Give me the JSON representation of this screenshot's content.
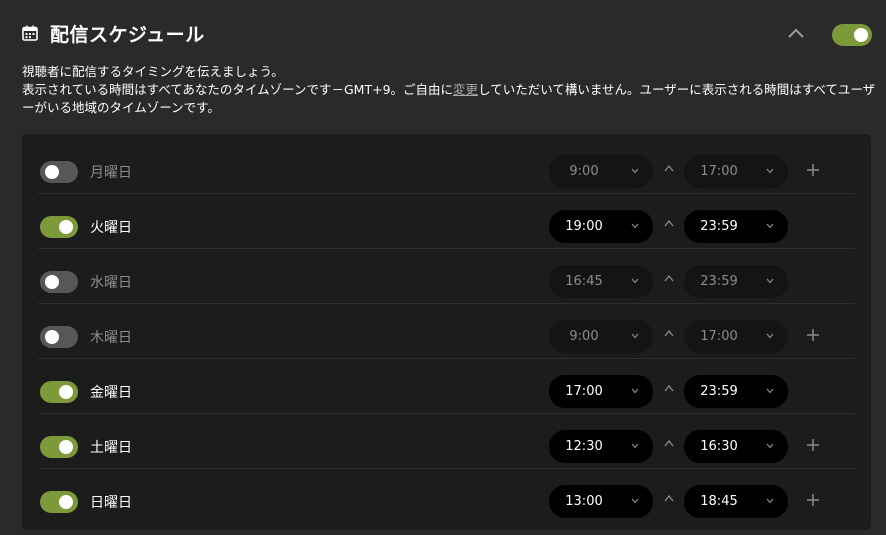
{
  "header": {
    "title": "配信スケジュール",
    "enabled": true
  },
  "description": {
    "line1": "視聴者に配信するタイミングを伝えましょう。",
    "line2_before": "表示されている時間はすべてあなたのタイムゾーンです－GMT+9。ご自由に",
    "line2_link": "変更",
    "line2_after": "していただいて構いません。ユーザーに表示される時間はすべてユーザーがいる地域のタイムゾーンです。"
  },
  "days": [
    {
      "label": "月曜日",
      "enabled": false,
      "start": "9:00",
      "end": "17:00",
      "has_add": true
    },
    {
      "label": "火曜日",
      "enabled": true,
      "start": "19:00",
      "end": "23:59",
      "has_add": false
    },
    {
      "label": "水曜日",
      "enabled": false,
      "start": "16:45",
      "end": "23:59",
      "has_add": false
    },
    {
      "label": "木曜日",
      "enabled": false,
      "start": "9:00",
      "end": "17:00",
      "has_add": true
    },
    {
      "label": "金曜日",
      "enabled": true,
      "start": "17:00",
      "end": "23:59",
      "has_add": false
    },
    {
      "label": "土曜日",
      "enabled": true,
      "start": "12:30",
      "end": "16:30",
      "has_add": true
    },
    {
      "label": "日曜日",
      "enabled": true,
      "start": "13:00",
      "end": "18:45",
      "has_add": true
    }
  ],
  "icons": {
    "header": "calendar-icon",
    "collapse": "chevron-up-icon",
    "dropdown": "chevron-down-icon",
    "separator": "caret-up-icon",
    "add": "plus-icon"
  },
  "colors": {
    "accent": "#7d9a3a",
    "background": "#2a2a2a",
    "panel": "#1c1c1c",
    "toggle_off": "#575757"
  }
}
